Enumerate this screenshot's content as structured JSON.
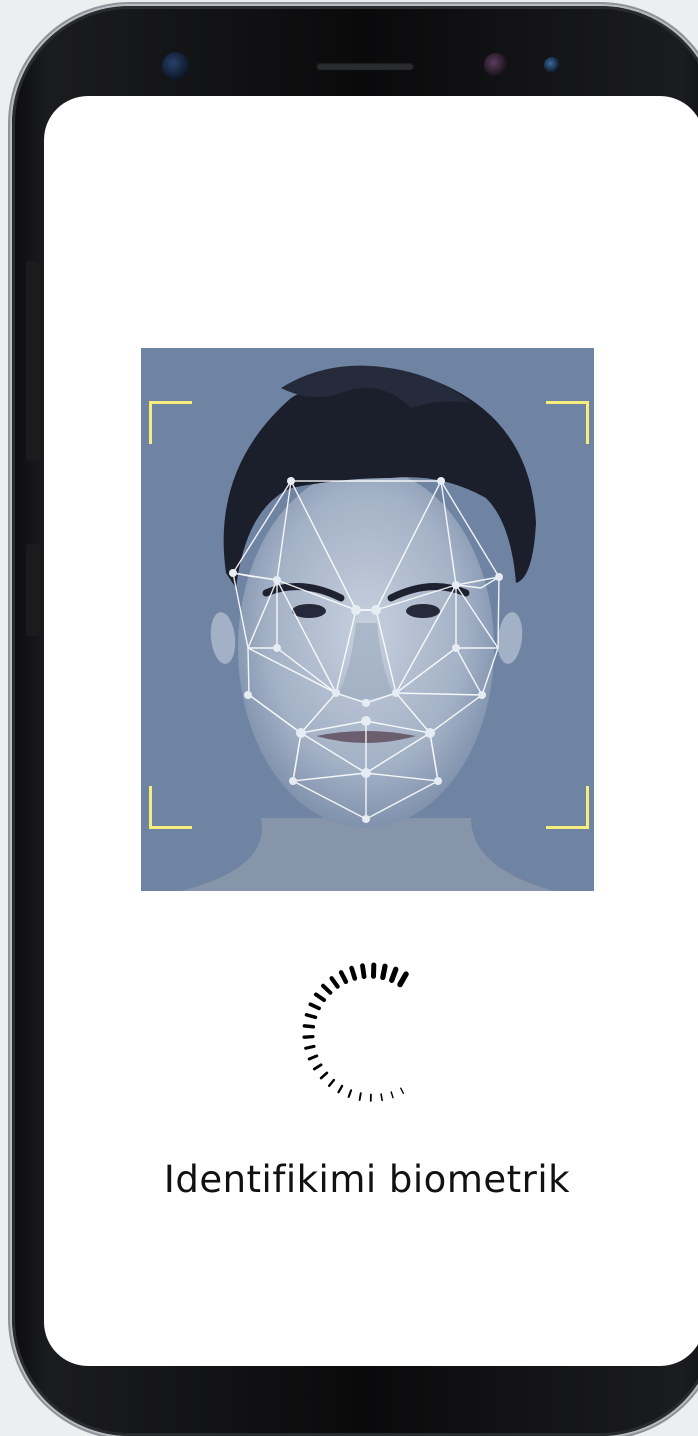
{
  "scan": {
    "status_label": "Identifikimi biometrik",
    "frame_color": "#f5ee7c",
    "background_color": "#6f84a3",
    "icon": "face-mesh-icon"
  },
  "spinner": {
    "icon": "loading-spinner-icon"
  }
}
